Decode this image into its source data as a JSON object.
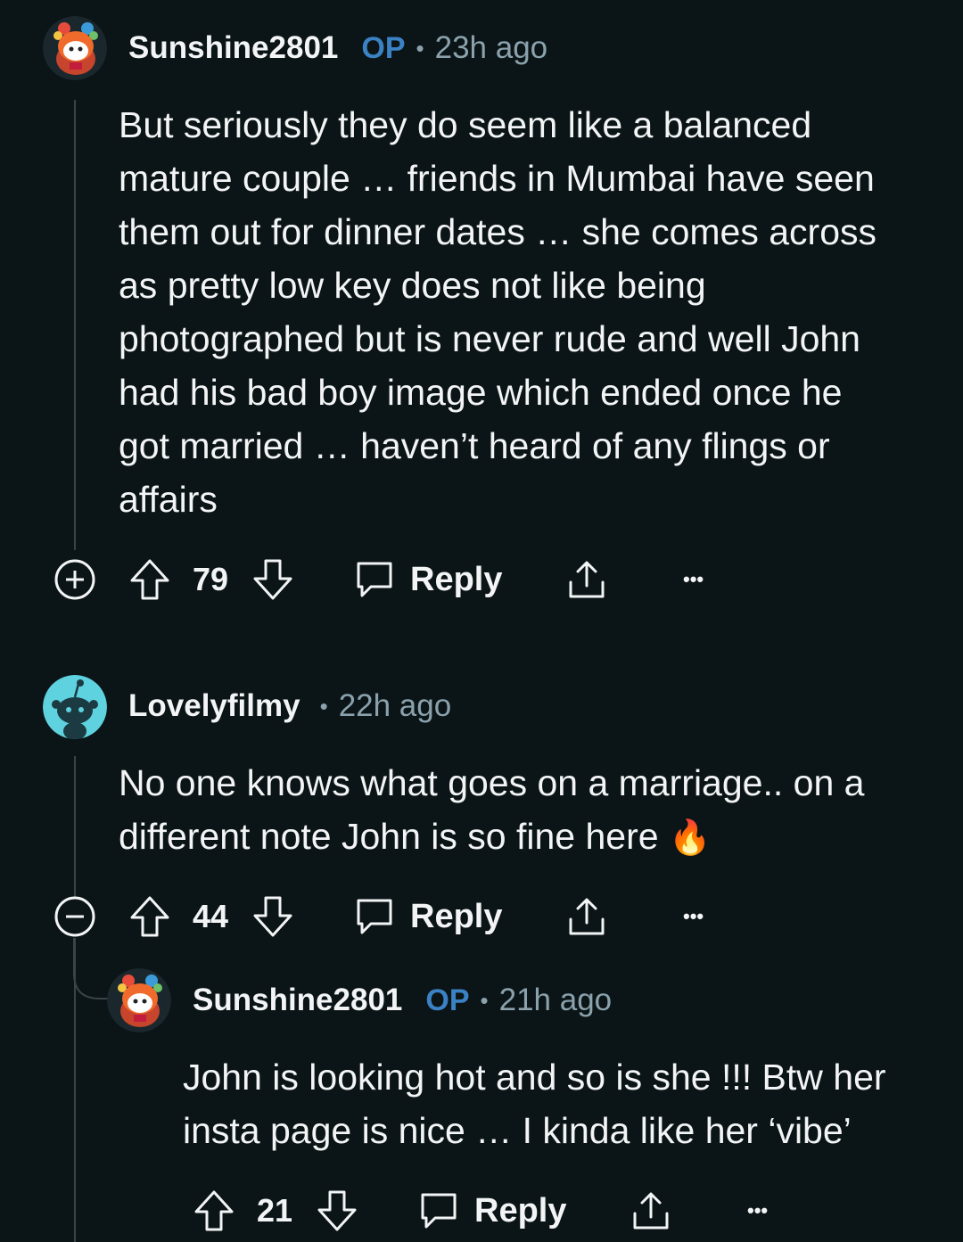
{
  "comments": [
    {
      "username": "Sunshine2801",
      "op_badge": "OP",
      "separator": "•",
      "time": "23h ago",
      "avatar_icon": "snoo-avatar-rainbow-icon",
      "body_lines": [
        "But seriously they do seem like a balanced",
        "mature couple … friends in Mumbai have seen",
        "them out for dinner dates … she comes across",
        "as pretty low key does not like being",
        "photographed but is never rude and well John",
        "had his bad boy image which ended once he",
        "got married … haven’t heard of any flings or",
        "affairs"
      ],
      "expand_icon": "plus-circle-icon",
      "votes": "79",
      "reply_label": "Reply",
      "more_label": "•••"
    },
    {
      "username": "Lovelyfilmy",
      "separator": "•",
      "time": "22h ago",
      "avatar_icon": "snoo-avatar-default-icon",
      "body_lines": [
        "No one knows what goes on a marriage.. on a",
        "different note John is so fine here"
      ],
      "emoji": "🔥",
      "expand_icon": "minus-circle-icon",
      "votes": "44",
      "reply_label": "Reply",
      "more_label": "•••"
    },
    {
      "username": "Sunshine2801",
      "op_badge": "OP",
      "separator": "•",
      "time": "21h ago",
      "avatar_icon": "snoo-avatar-rainbow-icon",
      "body_lines": [
        "John is looking hot and so is she !!! Btw her",
        "insta page is nice … I kinda like her ‘vibe’"
      ],
      "votes": "21",
      "reply_label": "Reply",
      "more_label": "•••"
    }
  ],
  "colors": {
    "background": "#0b1416",
    "text": "#f2f4f5",
    "muted": "#8ba2ad",
    "op": "#3b82c4",
    "thread_line": "#3a4347"
  }
}
